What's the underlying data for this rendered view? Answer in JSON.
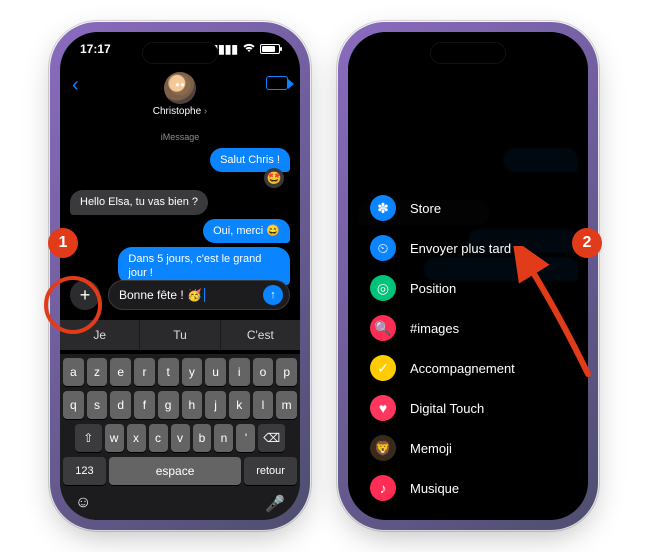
{
  "status": {
    "time": "17:17"
  },
  "contact": {
    "name": "Christophe",
    "service_label": "iMessage"
  },
  "messages": {
    "m1": "Salut Chris !",
    "m2_reaction": "🤩",
    "m3": "Hello Elsa, tu vas bien ?",
    "m4": "Oui, merci 😄",
    "m5": "Dans 5 jours, c'est le grand jour !"
  },
  "compose": {
    "draft": "Bonne fête ! 🥳"
  },
  "predictive": {
    "p1": "Je",
    "p2": "Tu",
    "p3": "C'est"
  },
  "keyboard": {
    "row1": [
      "a",
      "z",
      "e",
      "r",
      "t",
      "y",
      "u",
      "i",
      "o",
      "p"
    ],
    "row2": [
      "q",
      "s",
      "d",
      "f",
      "g",
      "h",
      "j",
      "k",
      "l",
      "m"
    ],
    "row3": [
      "⇧",
      "w",
      "x",
      "c",
      "v",
      "b",
      "n",
      "'",
      "⌫"
    ],
    "num_key": "123",
    "space_key": "espace",
    "return_key": "retour"
  },
  "sheet": {
    "items": {
      "store": {
        "label": "Store",
        "bg": "#0a84ff",
        "glyph": "✽"
      },
      "later": {
        "label": "Envoyer plus tard",
        "bg": "#0a84ff",
        "glyph": "⏲"
      },
      "location": {
        "label": "Position",
        "bg": "#00c37a",
        "glyph": "◎"
      },
      "images": {
        "label": "#images",
        "bg": "#ff2d55",
        "glyph": "🔍"
      },
      "audio": {
        "label": "Accompagnement",
        "bg": "#ffcc00",
        "glyph": "✓"
      },
      "touch": {
        "label": "Digital Touch",
        "bg": "#ff375f",
        "glyph": "♥"
      },
      "memoji": {
        "label": "Memoji",
        "bg": "#3a2a1a",
        "glyph": "🦁"
      },
      "music": {
        "label": "Musique",
        "bg": "#ff2d55",
        "glyph": "♪"
      }
    }
  },
  "badges": {
    "one": "1",
    "two": "2"
  }
}
